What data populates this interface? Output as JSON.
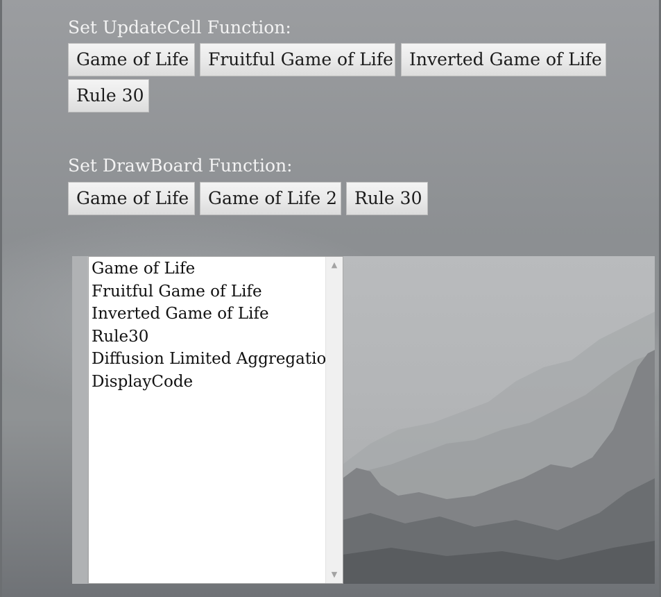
{
  "update_cell": {
    "label": "Set UpdateCell Function:",
    "buttons": [
      "Game of Life",
      "Fruitful Game of Life",
      "Inverted Game of Life",
      "Rule 30"
    ]
  },
  "draw_board": {
    "label": "Set DrawBoard Function:",
    "buttons": [
      "Game of Life",
      "Game of Life 2",
      "Rule 30"
    ]
  },
  "listbox": {
    "options": [
      "Game of Life",
      "Fruitful Game of Life",
      "Inverted Game of Life",
      "Rule30",
      "Diffusion Limited Aggregation",
      "DisplayCode"
    ]
  },
  "icons": {
    "scroll_up": "scroll-up-arrow-icon",
    "scroll_down": "scroll-down-arrow-icon"
  }
}
